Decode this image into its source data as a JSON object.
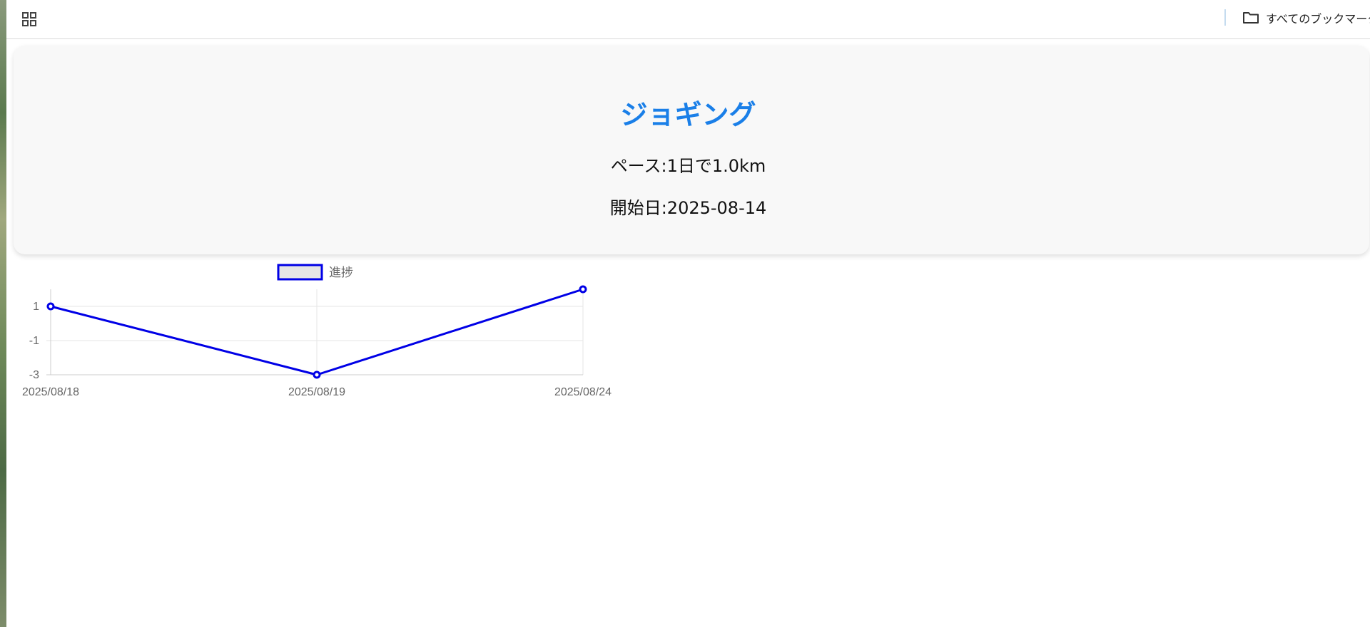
{
  "bookmarks_bar": {
    "apps_icon": "apps-grid-icon",
    "folder_icon": "folder-icon",
    "all_bookmarks_label": "すべてのブックマーク"
  },
  "goal": {
    "title": "ジョギング",
    "pace": "ペース:1日で1.0km",
    "start_date": "開始日:2025-08-14"
  },
  "colors": {
    "title": "#1a7fe8",
    "series_line": "#0000e6",
    "legend_fill": "#e6e6e6",
    "grid": "#e5e5e5"
  },
  "chart_data": {
    "type": "line",
    "categories": [
      "2025/08/18",
      "2025/08/19",
      "2025/08/24"
    ],
    "series": [
      {
        "name": "進捗",
        "values": [
          1,
          -3,
          2
        ]
      }
    ],
    "y_ticks": [
      "1",
      "-1",
      "-3"
    ],
    "ylim": [
      -3,
      2
    ],
    "legend_position": "top",
    "grid": true
  }
}
